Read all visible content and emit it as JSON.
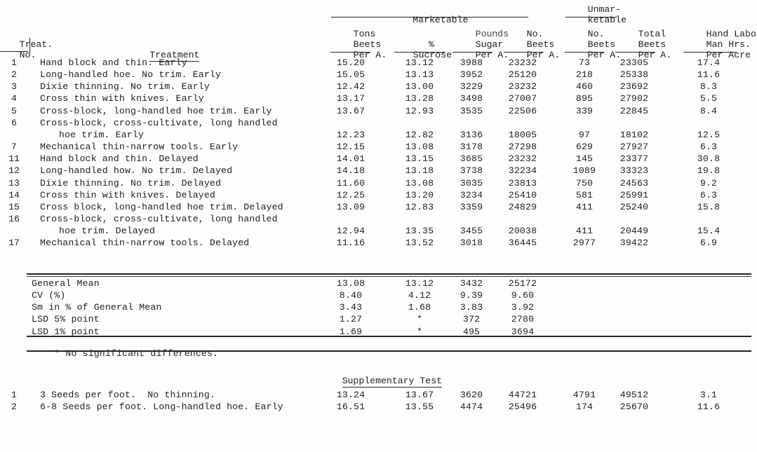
{
  "document": {
    "type": "agricultural-research-table",
    "column_group_headers": [
      {
        "label": "Marketable",
        "underlined": true
      },
      {
        "label": "Unmar-",
        "underlined": false,
        "clipped_top": true
      },
      {
        "label": "ketable",
        "underlined": true
      }
    ],
    "row_label_header": {
      "line1": "Treat.",
      "line2": "No."
    },
    "treatment_header": "Treatment",
    "columns": [
      {
        "line1": "Tons",
        "line2": "Beets",
        "line3": "Per A."
      },
      {
        "line1": "",
        "line2": "%",
        "line3": "Sucrose"
      },
      {
        "line1": "Pounds",
        "line2": "Sugar",
        "line3": "Per A."
      },
      {
        "line1": "No.",
        "line2": "Beets",
        "line3": "Per A."
      },
      {
        "line1": "No.",
        "line2": "Beets",
        "line3": "Per A."
      },
      {
        "line1": "Total",
        "line2": "Beets",
        "line3": "Per A."
      },
      {
        "line1": "Hand Labor",
        "line2": "Man Hrs.",
        "line3": "Per Acre"
      }
    ],
    "rows": [
      {
        "no": "1",
        "treatment": "Hand block and thin. Early",
        "treatment2": "",
        "values": [
          "15.20",
          "13.12",
          "3988",
          "23232",
          "73",
          "23305",
          "17.4"
        ]
      },
      {
        "no": "2",
        "treatment": "Long-handled hoe. No trim. Early",
        "treatment2": "",
        "values": [
          "15.05",
          "13.13",
          "3952",
          "25120",
          "218",
          "25338",
          "11.6"
        ]
      },
      {
        "no": "3",
        "treatment": "Dixie thinning. No trim. Early",
        "treatment2": "",
        "values": [
          "12.42",
          "13.00",
          "3229",
          "23232",
          "460",
          "23692",
          "8.3"
        ]
      },
      {
        "no": "4",
        "treatment": "Cross thin with knives. Early",
        "treatment2": "",
        "values": [
          "13.17",
          "13.28",
          "3498",
          "27007",
          "895",
          "27902",
          "5.5"
        ]
      },
      {
        "no": "5",
        "treatment": "Cross-block, long-handled hoe trim. Early",
        "treatment2": "",
        "values": [
          "13.67",
          "12.93",
          "3535",
          "22506",
          "339",
          "22845",
          "8.4"
        ]
      },
      {
        "no": "6",
        "treatment": "Cross-block, cross-cultivate, long handled",
        "treatment2": "hoe trim. Early",
        "values": [
          "12.23",
          "12.82",
          "3136",
          "18005",
          "97",
          "18102",
          "12.5"
        ]
      },
      {
        "no": "7",
        "treatment": "Mechanical thin-narrow tools. Early",
        "treatment2": "",
        "values": [
          "12.15",
          "13.08",
          "3178",
          "27298",
          "629",
          "27927",
          "6.3"
        ]
      },
      {
        "no": "11",
        "treatment": "Hand block and thin. Delayed",
        "treatment2": "",
        "values": [
          "14.01",
          "13.15",
          "3685",
          "23232",
          "145",
          "23377",
          "30.8"
        ]
      },
      {
        "no": "12",
        "treatment": "Long-handled how. No trim. Delayed",
        "treatment2": "",
        "values": [
          "14.18",
          "13.18",
          "3738",
          "32234",
          "1089",
          "33323",
          "19.8"
        ]
      },
      {
        "no": "13",
        "treatment": "Dixie thinning. No trim. Delayed",
        "treatment2": "",
        "values": [
          "11.60",
          "13.08",
          "3035",
          "23813",
          "750",
          "24563",
          "9.2"
        ]
      },
      {
        "no": "14",
        "treatment": "Cross thin with knives. Delayed",
        "treatment2": "",
        "values": [
          "12.25",
          "13.20",
          "3234",
          "25410",
          "581",
          "25991",
          "6.3"
        ]
      },
      {
        "no": "15",
        "treatment": "Cross block, long-handled hoe trim. Delayed",
        "treatment2": "",
        "values": [
          "13.09",
          "12.83",
          "3359",
          "24829",
          "411",
          "25240",
          "15.8"
        ]
      },
      {
        "no": "16",
        "treatment": "Cross-block, cross-cultivate, long handled",
        "treatment2": "hoe trim. Delayed",
        "values": [
          "12.94",
          "13.35",
          "3455",
          "20038",
          "411",
          "20449",
          "15.4"
        ]
      },
      {
        "no": "17",
        "treatment": "Mechanical thin-narrow tools. Delayed",
        "treatment2": "",
        "values": [
          "11.16",
          "13.52",
          "3018",
          "36445",
          "2977",
          "39422",
          "6.9"
        ]
      }
    ],
    "statistics": [
      {
        "label": "General Mean",
        "values": [
          "13.08",
          "13.12",
          "3432",
          "25172"
        ]
      },
      {
        "label": "CV (%)",
        "values": [
          "8.40",
          "4.12",
          "9.39",
          "9.60"
        ]
      },
      {
        "label": "Sm in % of General Mean",
        "values": [
          "3.43",
          "1.68",
          "3.83",
          "3.92"
        ]
      },
      {
        "label": "LSD 5% point",
        "values": [
          "1.27",
          "*",
          "372",
          "2780"
        ]
      },
      {
        "label": "LSD 1% point",
        "values": [
          "1.69",
          "*",
          "495",
          "3694"
        ]
      }
    ],
    "footnote": "* No significant differences.",
    "supplementary": {
      "title": "Supplementary Test",
      "rows": [
        {
          "no": "1",
          "treatment": "3 Seeds per foot.  No thinning.",
          "values": [
            "13.24",
            "13.67",
            "3620",
            "44721",
            "4791",
            "49512",
            "3.1"
          ]
        },
        {
          "no": "2",
          "treatment": "6-8 Seeds per foot. Long-handled hoe. Early",
          "values": [
            "16.51",
            "13.55",
            "4474",
            "25496",
            "174",
            "25670",
            "11.6"
          ]
        }
      ]
    }
  }
}
